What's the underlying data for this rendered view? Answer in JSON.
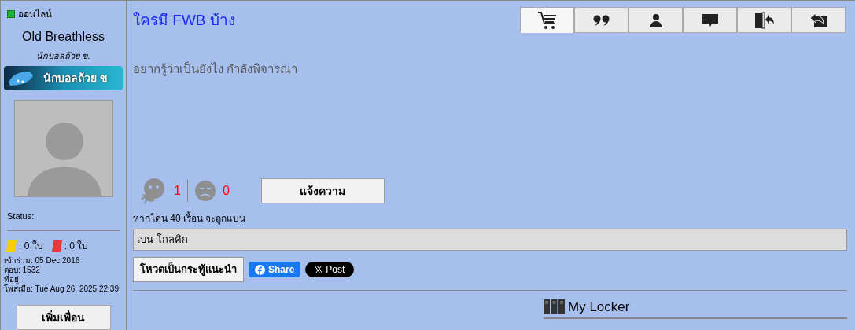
{
  "sidebar": {
    "online_label": "ออนไลน์",
    "username": "Old Breathless",
    "rank": "นักบอลถ้วย ข.",
    "rank_badge": "นักบอลถ้วย ข",
    "status_label": "Status:",
    "cards": [
      {
        "kind": "yellow",
        "count": ": 0 ใบ"
      },
      {
        "kind": "red",
        "count": ": 0 ใบ"
      }
    ],
    "info": [
      "เข้าร่วม: 05 Dec 2016",
      "ตอบ: 1532",
      "ที่อยู่:",
      "โพสเมื่อ: Tue Aug 26, 2025 22:39"
    ],
    "add_friend": "เพิ่มเพื่อน"
  },
  "post": {
    "title": "ใครมี FWB บ้าง",
    "toolbar": [
      {
        "kind": "cart",
        "selected": true
      },
      {
        "kind": "quote",
        "selected": false
      },
      {
        "kind": "user",
        "selected": false
      },
      {
        "kind": "comment",
        "selected": false
      },
      {
        "kind": "door",
        "selected": false
      },
      {
        "kind": "reply",
        "selected": false
      }
    ],
    "body": "อยากรู้ว่าเป็นยังไง กำลังพิจารณา",
    "reactions": [
      {
        "kind": "laugh",
        "count": "1"
      },
      {
        "kind": "sad",
        "count": "0"
      }
    ],
    "report_button": "แจ้งความ",
    "ban_note": "หากโดน 40 เรื้อน จะถูกแบน",
    "signature": "เบน โกลคิก",
    "vote_button": "โหวตเป็นกระทู้แนะนำ",
    "share_button": "Share",
    "post_button": "Post",
    "locker_title": "My Locker"
  }
}
